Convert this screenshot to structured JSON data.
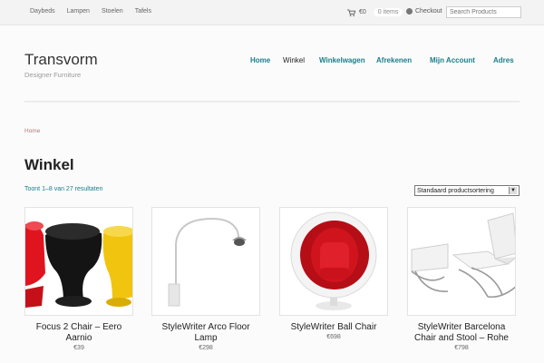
{
  "topbar": {
    "nav": [
      "Daybeds",
      "Lampen",
      "Stoelen",
      "Tafels"
    ],
    "cart_total": "€0",
    "cart_items": "0 items",
    "checkout": "Checkout",
    "search_placeholder": "Search Products"
  },
  "site": {
    "title": "Transvorm",
    "tagline": "Designer Furniture"
  },
  "mainnav": {
    "items": [
      "Home",
      "Winkel",
      "Winkelwagen",
      "Afrekenen",
      "Mijn Account",
      "Adres"
    ],
    "active": "Winkel"
  },
  "breadcrumb": "Home",
  "page_title": "Winkel",
  "results_text": "Toont 1–8 van 27 resultaten",
  "sort": {
    "selected": "Standaard productsortering"
  },
  "products": [
    {
      "name": "Focus 2 Chair – Eero Aarnio",
      "price": "€39"
    },
    {
      "name": "StyleWriter Arco Floor Lamp",
      "price": "€298"
    },
    {
      "name": "StyleWriter Ball Chair",
      "price": "€698"
    },
    {
      "name": "StyleWriter Barcelona Chair and Stool – Rohe",
      "price": "€798"
    }
  ],
  "colors": {
    "accent": "#1a7e8a",
    "ball_chair": "#d0141e"
  }
}
